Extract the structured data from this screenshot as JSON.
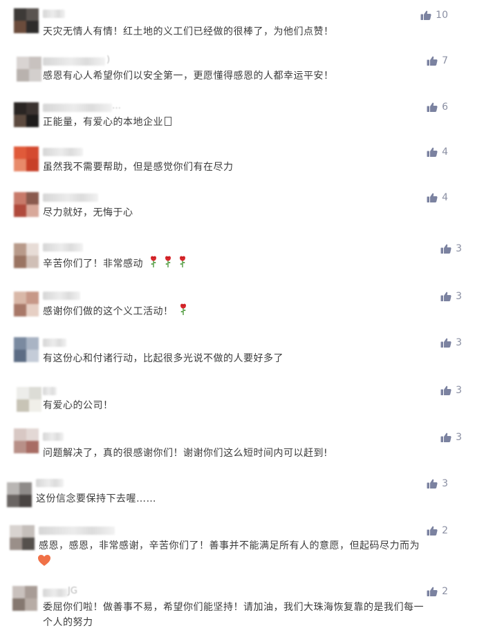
{
  "colors": {
    "like": "#8a8fa3",
    "text": "#3b3b3b",
    "background": "#ffffff"
  },
  "comments": [
    {
      "text": "天灾无情人有情！红土地的义工们已经做的很棒了，为他们点赞！",
      "likes": "10"
    },
    {
      "nick_hint": ")",
      "text": "感恩有心人希望你们以安全第一，更愿懂得感恩的人都幸运平安！",
      "likes": "7"
    },
    {
      "nick_hint": "…",
      "text": "正能量，有爱心的本地企业",
      "likes": "6"
    },
    {
      "text": "虽然我不需要帮助，但是感觉你们有在尽力",
      "likes": "4"
    },
    {
      "text": "尽力就好，无悔于心",
      "likes": "4"
    },
    {
      "text": "辛苦你们了！非常感动",
      "likes": "3"
    },
    {
      "text": "感谢你们做的这个义工活动！",
      "likes": "3"
    },
    {
      "text": "有这份心和付诸行动，比起很多光说不做的人要好多了",
      "likes": "3"
    },
    {
      "text": "有爱心的公司！",
      "likes": "3"
    },
    {
      "text": "问题解决了，真的很感谢你们！谢谢你们这么短时间内可以赶到!",
      "likes": "3"
    },
    {
      "text": "这份信念要保持下去喔……",
      "likes": "3"
    },
    {
      "text": "感恩，感恩，非常感谢，辛苦你们了！善事并不能满足所有人的意愿，但起码尽力而为",
      "likes": "2"
    },
    {
      "nick_hint": "JG",
      "text_line1": "委屈你们啦！做善事不易，希望你们能坚持！请加油，我们大珠海恢复靠的是我们每一",
      "text_line2": "个人的努力",
      "likes": "2"
    }
  ]
}
